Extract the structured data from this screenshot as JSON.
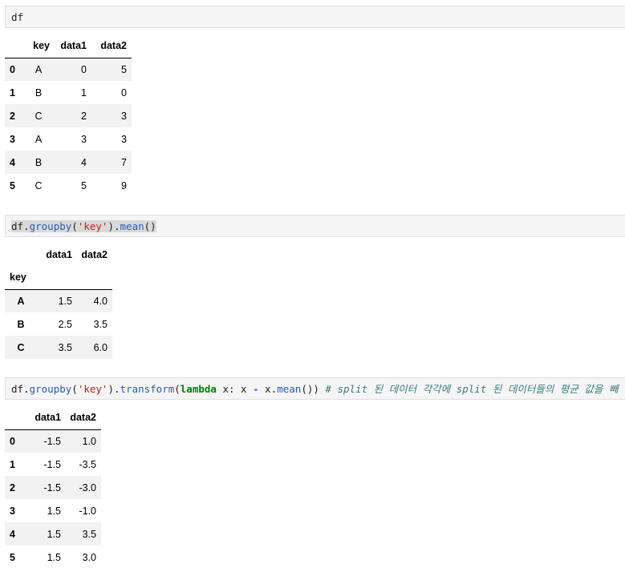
{
  "cells": [
    {
      "input": {
        "code": "df"
      },
      "output": {
        "columns": [
          "key",
          "data1",
          "data2"
        ],
        "rows": [
          {
            "index": "0",
            "values": [
              "A",
              "0",
              "5"
            ]
          },
          {
            "index": "1",
            "values": [
              "B",
              "1",
              "0"
            ]
          },
          {
            "index": "2",
            "values": [
              "C",
              "2",
              "3"
            ]
          },
          {
            "index": "3",
            "values": [
              "A",
              "3",
              "3"
            ]
          },
          {
            "index": "4",
            "values": [
              "B",
              "4",
              "7"
            ]
          },
          {
            "index": "5",
            "values": [
              "C",
              "5",
              "9"
            ]
          }
        ]
      }
    },
    {
      "input": {
        "tokens": [
          {
            "t": "df",
            "c": ""
          },
          {
            "t": ".",
            "c": ""
          },
          {
            "t": "groupby",
            "c": "fn"
          },
          {
            "t": "(",
            "c": ""
          },
          {
            "t": "'key'",
            "c": "str"
          },
          {
            "t": ").",
            "c": ""
          },
          {
            "t": "mean",
            "c": "fn"
          },
          {
            "t": "()",
            "c": ""
          }
        ]
      },
      "output": {
        "columns": [
          "data1",
          "data2"
        ],
        "index_name": "key",
        "rows": [
          {
            "index": "A",
            "values": [
              "1.5",
              "4.0"
            ]
          },
          {
            "index": "B",
            "values": [
              "2.5",
              "3.5"
            ]
          },
          {
            "index": "C",
            "values": [
              "3.5",
              "6.0"
            ]
          }
        ]
      }
    },
    {
      "input": {
        "tokens": [
          {
            "t": "df",
            "c": ""
          },
          {
            "t": ".",
            "c": ""
          },
          {
            "t": "groupby",
            "c": "fn"
          },
          {
            "t": "(",
            "c": ""
          },
          {
            "t": "'key'",
            "c": "str"
          },
          {
            "t": ").",
            "c": ""
          },
          {
            "t": "transform",
            "c": "fn"
          },
          {
            "t": "(",
            "c": ""
          },
          {
            "t": "lambda",
            "c": "kw"
          },
          {
            "t": " x: x ",
            "c": ""
          },
          {
            "t": "-",
            "c": "op"
          },
          {
            "t": " x.",
            "c": ""
          },
          {
            "t": "mean",
            "c": "fn"
          },
          {
            "t": "()) ",
            "c": ""
          },
          {
            "t": "# split 된 데이터 각각에 split 된 데이터들의 평균 값을 빼",
            "c": "cm"
          }
        ]
      },
      "output": {
        "columns": [
          "data1",
          "data2"
        ],
        "rows": [
          {
            "index": "0",
            "values": [
              "-1.5",
              "1.0"
            ]
          },
          {
            "index": "1",
            "values": [
              "-1.5",
              "-3.5"
            ]
          },
          {
            "index": "2",
            "values": [
              "-1.5",
              "-3.0"
            ]
          },
          {
            "index": "3",
            "values": [
              "1.5",
              "-1.0"
            ]
          },
          {
            "index": "4",
            "values": [
              "1.5",
              "3.5"
            ]
          },
          {
            "index": "5",
            "values": [
              "1.5",
              "3.0"
            ]
          }
        ]
      }
    }
  ]
}
